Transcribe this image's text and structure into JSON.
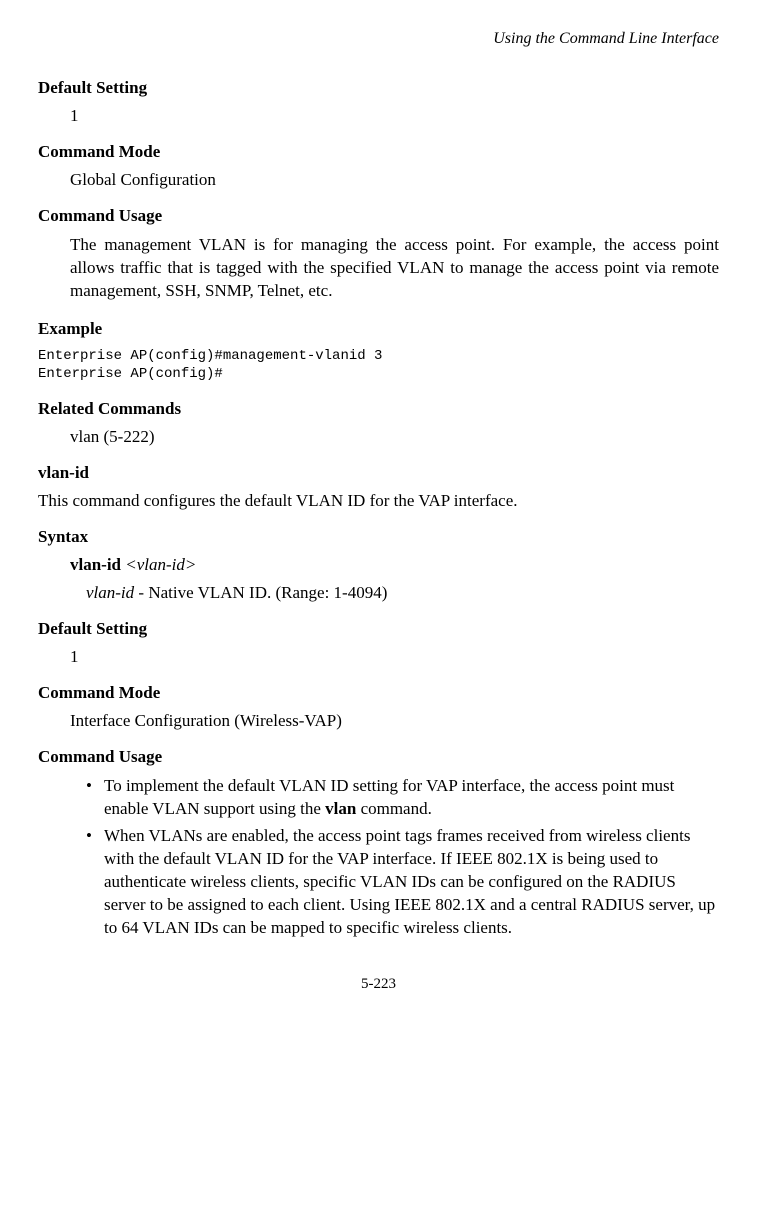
{
  "header": {
    "title": "Using the Command Line Interface"
  },
  "sections": {
    "defaultSetting1": {
      "heading": "Default Setting",
      "value": "1"
    },
    "commandMode1": {
      "heading": "Command Mode",
      "value": "Global Configuration"
    },
    "commandUsage1": {
      "heading": "Command Usage",
      "text": "The management VLAN is for managing the access point. For example, the access point allows traffic that is tagged with the specified VLAN to manage the access point via remote management, SSH, SNMP, Telnet, etc."
    },
    "example": {
      "heading": "Example",
      "code": "Enterprise AP(config)#management-vlanid 3\nEnterprise AP(config)#"
    },
    "relatedCommands": {
      "heading": "Related Commands",
      "value": "vlan (5-222)"
    },
    "vlanId": {
      "heading": "vlan-id",
      "description": "This command configures the default VLAN ID for the VAP interface."
    },
    "syntax": {
      "heading": "Syntax",
      "cmdBold": "vlan-id ",
      "cmdArg": "<vlan-id>",
      "paramName": "vlan-id",
      "paramDesc": " - Native VLAN ID. (Range: 1-4094)"
    },
    "defaultSetting2": {
      "heading": "Default Setting",
      "value": "1"
    },
    "commandMode2": {
      "heading": "Command Mode",
      "value": "Interface Configuration (Wireless-VAP)"
    },
    "commandUsage2": {
      "heading": "Command Usage",
      "bullets": {
        "b1a": "To implement the default VLAN ID setting for VAP interface, the access point must enable VLAN support using the ",
        "b1bold": "vlan",
        "b1b": " command.",
        "b2": "When VLANs are enabled, the access point tags frames received from wireless clients with the default VLAN ID for the VAP interface. If IEEE 802.1X is being used to authenticate wireless clients, specific VLAN IDs can be configured on the RADIUS server to be assigned to each client. Using IEEE 802.1X and a central RADIUS server, up to 64 VLAN IDs can be mapped to specific wireless clients."
      }
    }
  },
  "footer": {
    "pageNumber": "5-223"
  }
}
